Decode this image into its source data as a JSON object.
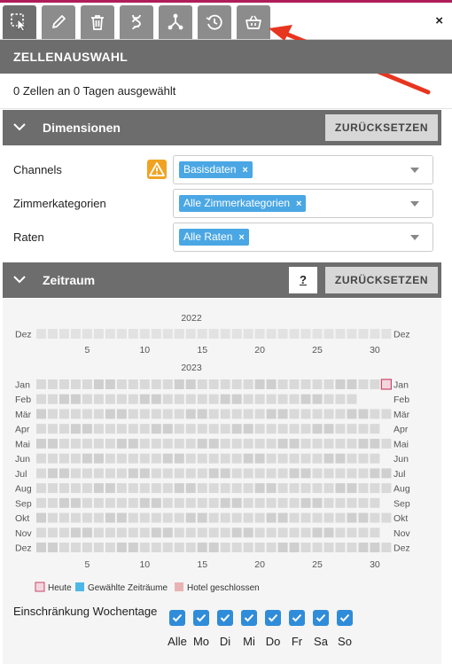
{
  "tabs": [
    {
      "name": "tab-cell-selection",
      "icon": "cursor-select-icon",
      "active": true
    },
    {
      "name": "tab-edit",
      "icon": "pencil-icon"
    },
    {
      "name": "tab-delete",
      "icon": "trash-icon"
    },
    {
      "name": "tab-dna",
      "icon": "dna-icon"
    },
    {
      "name": "tab-distribution",
      "icon": "network-icon"
    },
    {
      "name": "tab-history",
      "icon": "history-clock-icon"
    },
    {
      "name": "tab-basket",
      "icon": "basket-icon"
    }
  ],
  "close_label": "×",
  "section_title": "ZELLENAUSWAHL",
  "selection_count": "0 Zellen an 0 Tagen ausgewählt",
  "dimensions": {
    "title": "Dimensionen",
    "reset_label": "ZURÜCKSETZEN",
    "rows": [
      {
        "label": "Channels",
        "chip": "Basisdaten",
        "warning": true
      },
      {
        "label": "Zimmerkategorien",
        "chip": "Alle Zimmerkategorien"
      },
      {
        "label": "Raten",
        "chip": "Alle Raten"
      }
    ],
    "chip_remove": "×"
  },
  "zeitraum": {
    "title": "Zeitraum",
    "help_label": "?",
    "reset_label": "ZURÜCKSETZEN"
  },
  "calendar": {
    "years": [
      {
        "year": "2022",
        "months": [
          {
            "label": "Dez",
            "days": 31
          }
        ]
      },
      {
        "year": "2023",
        "months": [
          {
            "label": "Jan",
            "days": 31
          },
          {
            "label": "Feb",
            "days": 28
          },
          {
            "label": "Mär",
            "days": 31
          },
          {
            "label": "Apr",
            "days": 30
          },
          {
            "label": "Mai",
            "days": 31
          },
          {
            "label": "Jun",
            "days": 30
          },
          {
            "label": "Jul",
            "days": 31
          },
          {
            "label": "Aug",
            "days": 31
          },
          {
            "label": "Sep",
            "days": 30
          },
          {
            "label": "Okt",
            "days": 31
          },
          {
            "label": "Nov",
            "days": 30
          },
          {
            "label": "Dez",
            "days": 31
          }
        ]
      }
    ],
    "day_ticks": [
      "5",
      "10",
      "15",
      "20",
      "25",
      "30"
    ],
    "today": {
      "month": "Jan",
      "day": 31
    },
    "legend": [
      "Heute",
      "Gewählte Zeiträume",
      "Hotel geschlossen"
    ],
    "colors": {
      "today_border": "#c9476b",
      "selected": "#4cb7e8",
      "closed": "#e9b3b3"
    }
  },
  "weekdays": {
    "title": "Einschränkung Wochentage",
    "days": [
      "Alle",
      "Mo",
      "Di",
      "Mi",
      "Do",
      "Fr",
      "Sa",
      "So"
    ],
    "checked": [
      true,
      true,
      true,
      true,
      true,
      true,
      true,
      true
    ]
  },
  "colors": {
    "header": "#6d6d6d",
    "accent": "#b01d5b",
    "chip": "#4aa7e4",
    "checkbox": "#2f8cd9",
    "warning": "#f0a323"
  }
}
